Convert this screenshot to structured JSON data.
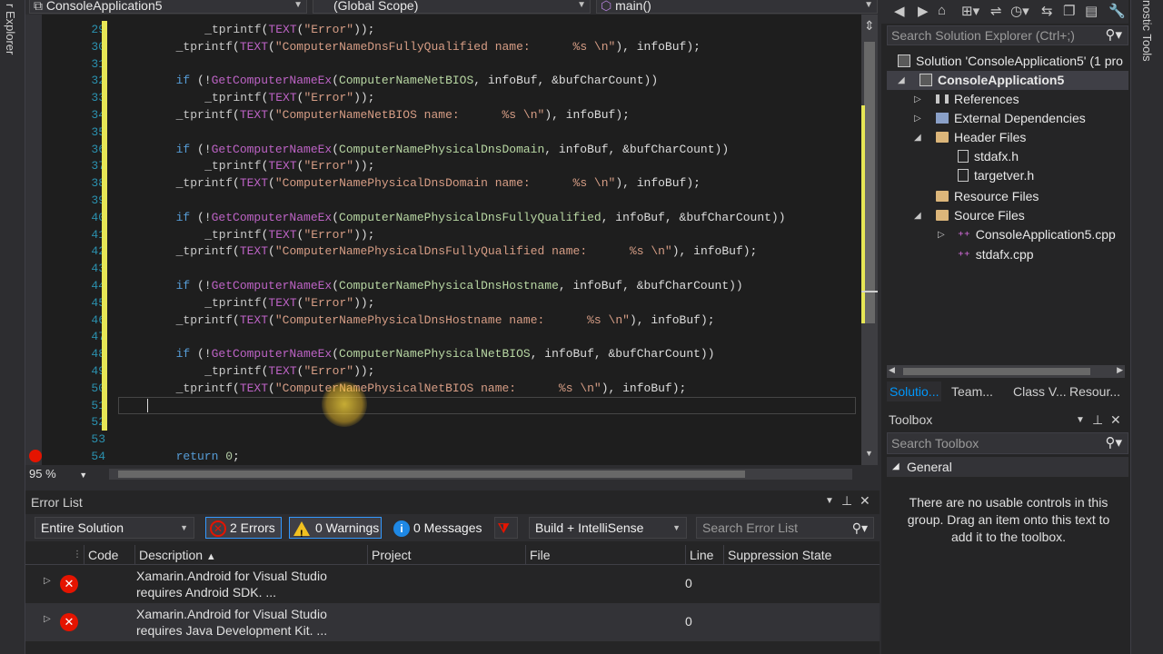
{
  "left_strip": {
    "label": "r Explorer"
  },
  "right_strip": {
    "label": "nostic Tools"
  },
  "nav": {
    "project": "ConsoleApplication5",
    "scope": "(Global Scope)",
    "member": "main()"
  },
  "code_lines": [
    {
      "n": "29",
      "indent": 8,
      "tokens": [
        [
          "fn",
          "_tprintf"
        ],
        [
          "p",
          "("
        ],
        [
          "mac",
          "TEXT"
        ],
        [
          "p",
          "("
        ],
        [
          "str",
          "\"Error\""
        ],
        [
          "p",
          "));"
        ]
      ]
    },
    {
      "n": "30",
      "indent": 4,
      "tokens": [
        [
          "fn",
          "_tprintf"
        ],
        [
          "p",
          "("
        ],
        [
          "mac",
          "TEXT"
        ],
        [
          "p",
          "("
        ],
        [
          "str",
          "\"ComputerNameDnsFullyQualified name:      %s \\n\""
        ],
        [
          "p",
          "), infoBuf);"
        ]
      ]
    },
    {
      "n": "31",
      "indent": 0,
      "tokens": []
    },
    {
      "n": "32",
      "indent": 4,
      "tokens": [
        [
          "kw",
          "if"
        ],
        [
          "p",
          " (!"
        ],
        [
          "mac",
          "GetComputerNameEx"
        ],
        [
          "p",
          "("
        ],
        [
          "en",
          "ComputerNameNetBIOS"
        ],
        [
          "p",
          ", infoBuf, &bufCharCount))"
        ]
      ]
    },
    {
      "n": "33",
      "indent": 8,
      "tokens": [
        [
          "fn",
          "_tprintf"
        ],
        [
          "p",
          "("
        ],
        [
          "mac",
          "TEXT"
        ],
        [
          "p",
          "("
        ],
        [
          "str",
          "\"Error\""
        ],
        [
          "p",
          "));"
        ]
      ]
    },
    {
      "n": "34",
      "indent": 4,
      "tokens": [
        [
          "fn",
          "_tprintf"
        ],
        [
          "p",
          "("
        ],
        [
          "mac",
          "TEXT"
        ],
        [
          "p",
          "("
        ],
        [
          "str",
          "\"ComputerNameNetBIOS name:      %s \\n\""
        ],
        [
          "p",
          "), infoBuf);"
        ]
      ]
    },
    {
      "n": "35",
      "indent": 0,
      "tokens": []
    },
    {
      "n": "36",
      "indent": 4,
      "tokens": [
        [
          "kw",
          "if"
        ],
        [
          "p",
          " (!"
        ],
        [
          "mac",
          "GetComputerNameEx"
        ],
        [
          "p",
          "("
        ],
        [
          "en",
          "ComputerNamePhysicalDnsDomain"
        ],
        [
          "p",
          ", infoBuf, &bufCharCount))"
        ]
      ]
    },
    {
      "n": "37",
      "indent": 8,
      "tokens": [
        [
          "fn",
          "_tprintf"
        ],
        [
          "p",
          "("
        ],
        [
          "mac",
          "TEXT"
        ],
        [
          "p",
          "("
        ],
        [
          "str",
          "\"Error\""
        ],
        [
          "p",
          "));"
        ]
      ]
    },
    {
      "n": "38",
      "indent": 4,
      "tokens": [
        [
          "fn",
          "_tprintf"
        ],
        [
          "p",
          "("
        ],
        [
          "mac",
          "TEXT"
        ],
        [
          "p",
          "("
        ],
        [
          "str",
          "\"ComputerNamePhysicalDnsDomain name:      %s \\n\""
        ],
        [
          "p",
          "), infoBuf);"
        ]
      ]
    },
    {
      "n": "39",
      "indent": 0,
      "tokens": []
    },
    {
      "n": "40",
      "indent": 4,
      "tokens": [
        [
          "kw",
          "if"
        ],
        [
          "p",
          " (!"
        ],
        [
          "mac",
          "GetComputerNameEx"
        ],
        [
          "p",
          "("
        ],
        [
          "en",
          "ComputerNamePhysicalDnsFullyQualified"
        ],
        [
          "p",
          ", infoBuf, &bufCharCount))"
        ]
      ]
    },
    {
      "n": "41",
      "indent": 8,
      "tokens": [
        [
          "fn",
          "_tprintf"
        ],
        [
          "p",
          "("
        ],
        [
          "mac",
          "TEXT"
        ],
        [
          "p",
          "("
        ],
        [
          "str",
          "\"Error\""
        ],
        [
          "p",
          "));"
        ]
      ]
    },
    {
      "n": "42",
      "indent": 4,
      "tokens": [
        [
          "fn",
          "_tprintf"
        ],
        [
          "p",
          "("
        ],
        [
          "mac",
          "TEXT"
        ],
        [
          "p",
          "("
        ],
        [
          "str",
          "\"ComputerNamePhysicalDnsFullyQualified name:      %s \\n\""
        ],
        [
          "p",
          "), infoBuf);"
        ]
      ]
    },
    {
      "n": "43",
      "indent": 0,
      "tokens": []
    },
    {
      "n": "44",
      "indent": 4,
      "tokens": [
        [
          "kw",
          "if"
        ],
        [
          "p",
          " (!"
        ],
        [
          "mac",
          "GetComputerNameEx"
        ],
        [
          "p",
          "("
        ],
        [
          "en",
          "ComputerNamePhysicalDnsHostname"
        ],
        [
          "p",
          ", infoBuf, &bufCharCount))"
        ]
      ]
    },
    {
      "n": "45",
      "indent": 8,
      "tokens": [
        [
          "fn",
          "_tprintf"
        ],
        [
          "p",
          "("
        ],
        [
          "mac",
          "TEXT"
        ],
        [
          "p",
          "("
        ],
        [
          "str",
          "\"Error\""
        ],
        [
          "p",
          "));"
        ]
      ]
    },
    {
      "n": "46",
      "indent": 4,
      "tokens": [
        [
          "fn",
          "_tprintf"
        ],
        [
          "p",
          "("
        ],
        [
          "mac",
          "TEXT"
        ],
        [
          "p",
          "("
        ],
        [
          "str",
          "\"ComputerNamePhysicalDnsHostname name:      %s \\n\""
        ],
        [
          "p",
          "), infoBuf);"
        ]
      ]
    },
    {
      "n": "47",
      "indent": 0,
      "tokens": []
    },
    {
      "n": "48",
      "indent": 4,
      "tokens": [
        [
          "kw",
          "if"
        ],
        [
          "p",
          " (!"
        ],
        [
          "mac",
          "GetComputerNameEx"
        ],
        [
          "p",
          "("
        ],
        [
          "en",
          "ComputerNamePhysicalNetBIOS"
        ],
        [
          "p",
          ", infoBuf, &bufCharCount))"
        ]
      ]
    },
    {
      "n": "49",
      "indent": 8,
      "tokens": [
        [
          "fn",
          "_tprintf"
        ],
        [
          "p",
          "("
        ],
        [
          "mac",
          "TEXT"
        ],
        [
          "p",
          "("
        ],
        [
          "str",
          "\"Error\""
        ],
        [
          "p",
          "));"
        ]
      ]
    },
    {
      "n": "50",
      "indent": 4,
      "tokens": [
        [
          "fn",
          "_tprintf"
        ],
        [
          "p",
          "("
        ],
        [
          "mac",
          "TEXT"
        ],
        [
          "p",
          "("
        ],
        [
          "str",
          "\"ComputerNamePhysicalNetBIOS name:      %s \\n\""
        ],
        [
          "p",
          "), infoBuf);"
        ]
      ]
    },
    {
      "n": "51",
      "indent": 0,
      "tokens": []
    },
    {
      "n": "52",
      "indent": 0,
      "tokens": []
    },
    {
      "n": "53",
      "indent": 0,
      "tokens": []
    },
    {
      "n": "54",
      "indent": 4,
      "tokens": [
        [
          "kw",
          "return"
        ],
        [
          "p",
          " "
        ],
        [
          "num",
          "0"
        ],
        [
          "p",
          ";"
        ]
      ]
    }
  ],
  "zoom": "95 %",
  "error_list": {
    "title": "Error List",
    "scope_value": "Entire Solution",
    "errors_label": "2 Errors",
    "warnings_label": "0 Warnings",
    "messages_label": "0 Messages",
    "build_filter": "Build + IntelliSense",
    "search_placeholder": "Search Error List",
    "columns": {
      "code": "Code",
      "description": "Description",
      "project": "Project",
      "file": "File",
      "line": "Line",
      "suppression": "Suppression State"
    },
    "rows": [
      {
        "desc1": "Xamarin.Android for Visual Studio",
        "desc2": "requires Android SDK.  ...",
        "line": "0"
      },
      {
        "desc1": "Xamarin.Android for Visual Studio",
        "desc2": "requires Java Development Kit.  ...",
        "line": "0"
      }
    ]
  },
  "solution_explorer": {
    "search_placeholder": "Search Solution Explorer (Ctrl+;)",
    "items": {
      "solution": "Solution 'ConsoleApplication5' (1 pro",
      "project": "ConsoleApplication5",
      "references": "References",
      "external": "External Dependencies",
      "header_files": "Header Files",
      "stdafx_h": "stdafx.h",
      "targetver_h": "targetver.h",
      "resource_files": "Resource Files",
      "source_files": "Source Files",
      "main_cpp": "ConsoleApplication5.cpp",
      "stdafx_cpp": "stdafx.cpp"
    },
    "tabs": [
      "Solutio...",
      "Team...",
      "Class V...",
      "Resour..."
    ]
  },
  "toolbox": {
    "title": "Toolbox",
    "search_placeholder": "Search Toolbox",
    "group": "General",
    "empty_text": "There are no usable controls in this group. Drag an item onto this text to add it to the toolbox."
  },
  "colors": {
    "keyword": "#569cd6",
    "string": "#d69d85",
    "macro": "#bd63c5",
    "enum": "#b8d7a3",
    "line_number": "#2b91af",
    "error": "#e51400"
  }
}
